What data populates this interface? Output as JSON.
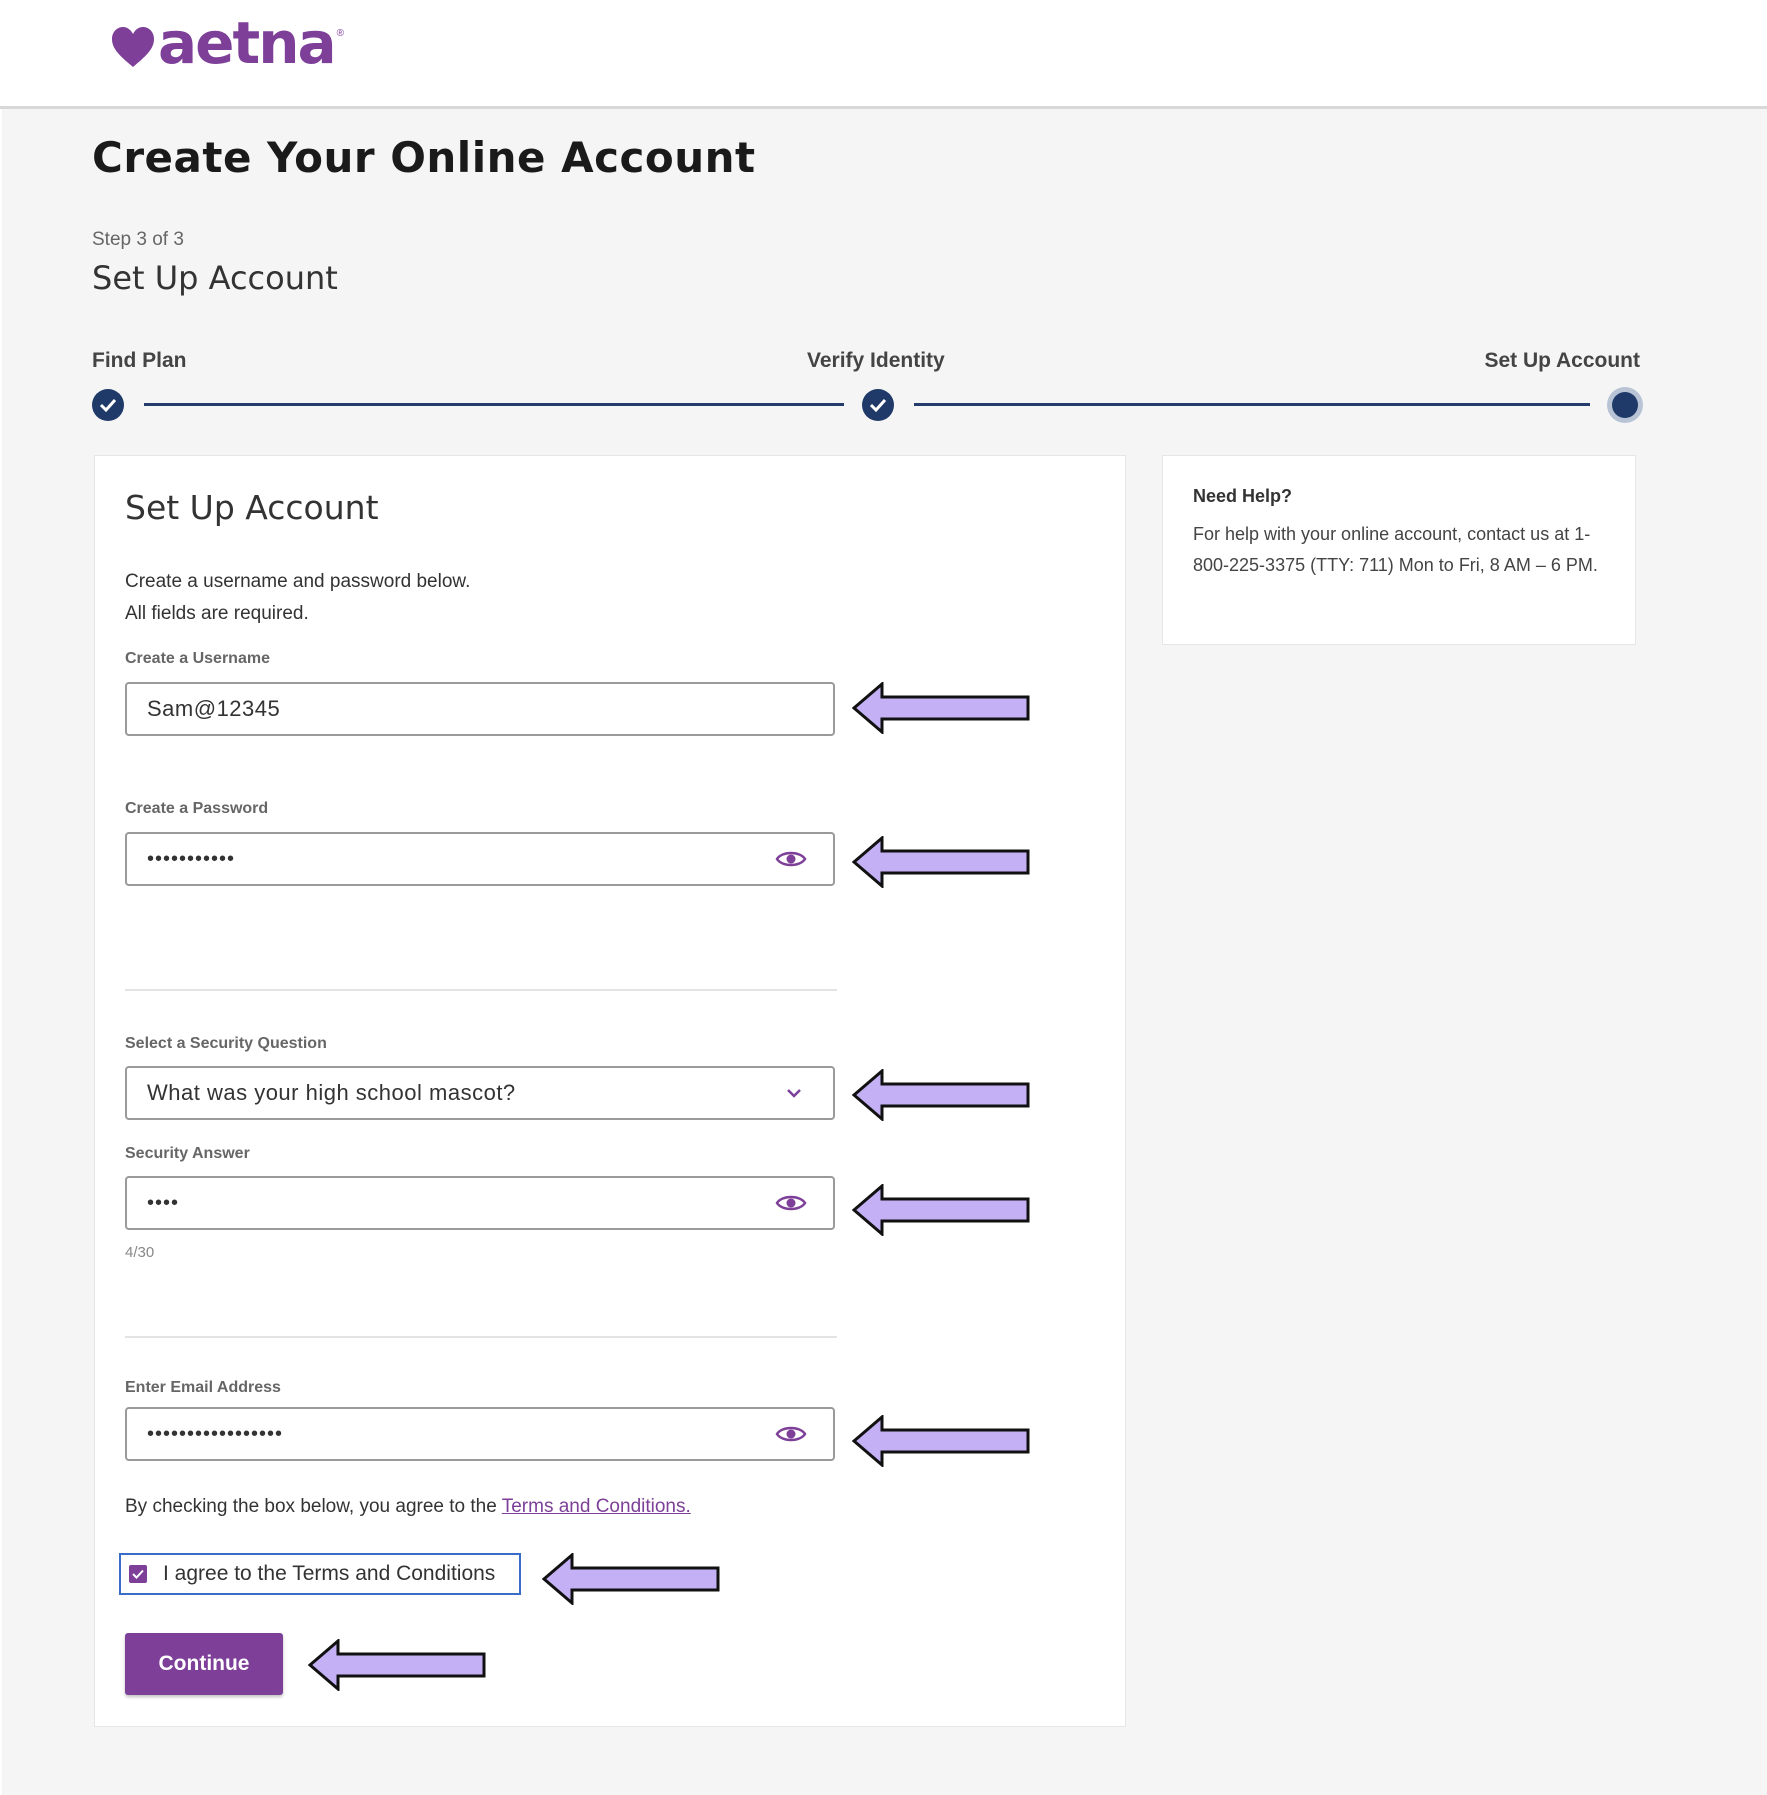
{
  "brand": {
    "name": "aetna",
    "tm": "®",
    "color": "#7d3f98"
  },
  "page": {
    "title": "Create Your Online Account",
    "step_label": "Step 3 of 3",
    "step_title": "Set Up Account"
  },
  "progress": {
    "steps": [
      {
        "label": "Find Plan",
        "status": "complete"
      },
      {
        "label": "Verify Identity",
        "status": "complete"
      },
      {
        "label": "Set Up Account",
        "status": "current"
      }
    ]
  },
  "form": {
    "title": "Set Up Account",
    "intro_line1": "Create a username and password below.",
    "intro_line2": "All fields are required.",
    "username": {
      "label": "Create a Username",
      "value": "Sam@12345"
    },
    "password": {
      "label": "Create a Password",
      "value": "•••••••••••",
      "icon": "eye-icon"
    },
    "security_question": {
      "label": "Select a Security Question",
      "value": "What was your high school mascot?",
      "icon": "chevron-down-icon"
    },
    "security_answer": {
      "label": "Security Answer",
      "value": "••••",
      "counter": "4/30",
      "icon": "eye-icon"
    },
    "email": {
      "label": "Enter Email Address",
      "value": "•••••••••••••••••",
      "icon": "eye-icon"
    },
    "terms_text": "By checking the box below, you agree to the ",
    "terms_link": "Terms and Conditions.",
    "agree_label": "I agree to the Terms and Conditions",
    "agree_checked": true,
    "continue_label": "Continue"
  },
  "help": {
    "title": "Need Help?",
    "body": "For help with your online account, contact us at 1-800-225-3375 (TTY: 711) Mon to Fri, 8 AM – 6 PM."
  },
  "annotation": {
    "arrow_color": "#c4b0f5",
    "arrow_icon": "left-arrow-icon"
  }
}
